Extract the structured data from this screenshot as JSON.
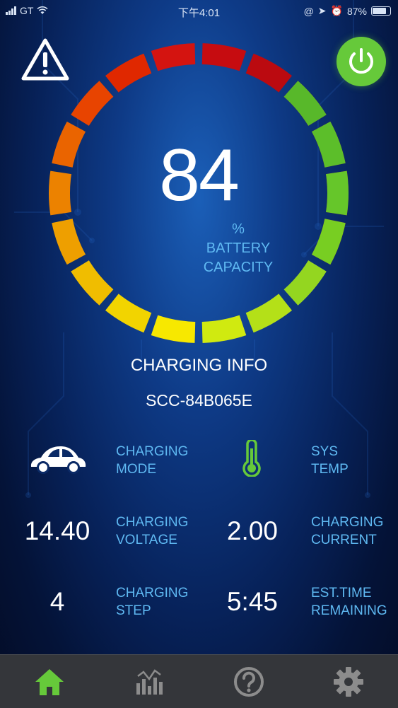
{
  "status_bar": {
    "carrier": "GT",
    "time": "下午4:01",
    "battery_percent": "87%",
    "battery_level": 0.87
  },
  "battery": {
    "capacity_value": "84",
    "capacity_level": 0.84,
    "unit": "%",
    "label_line1": "BATTERY",
    "label_line2": "CAPACITY"
  },
  "section_title": "CHARGING INFO",
  "device_id": "SCC-84B065E",
  "info": {
    "mode_label_1": "CHARGING",
    "mode_label_2": "MODE",
    "temp_label_1": "SYS",
    "temp_label_2": "TEMP",
    "voltage_value": "14.40",
    "voltage_label_1": "CHARGING",
    "voltage_label_2": "VOLTAGE",
    "current_value": "2.00",
    "current_label_1": "CHARGING",
    "current_label_2": "CURRENT",
    "step_value": "4",
    "step_label_1": "CHARGING",
    "step_label_2": "STEP",
    "time_value": "5:45",
    "time_label_1": "EST.TIME",
    "time_label_2": "REMAINING"
  },
  "icons": {
    "warning": "warning-triangle-icon",
    "power": "power-icon",
    "car": "car-icon",
    "thermometer": "thermometer-icon",
    "home": "home-icon",
    "chart": "chart-icon",
    "help": "help-icon",
    "settings": "settings-icon"
  },
  "colors": {
    "accent_green": "#66c93a",
    "label_blue": "#5fb9f2",
    "tab_bar": "#34363a",
    "inactive_tab": "#8c8c8c"
  }
}
